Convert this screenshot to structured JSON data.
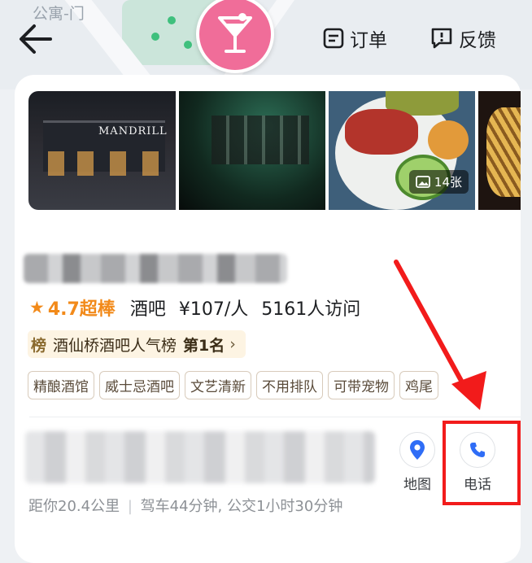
{
  "map": {
    "label": "公寓-门"
  },
  "header": {
    "back_icon": "back-arrow-icon",
    "category_icon": "cocktail-icon",
    "orders_label": "订单",
    "feedback_label": "反馈"
  },
  "gallery": {
    "photo_count_label": "14张"
  },
  "place": {
    "rating": "4.7超棒",
    "category": "酒吧",
    "price": "¥107/人",
    "visits": "5161人访问",
    "rank_badge": "榜",
    "rank_list": "酒仙桥酒吧人气榜",
    "rank_position": "第1名",
    "tags": [
      "精酿酒馆",
      "威士忌酒吧",
      "文艺清新",
      "不用排队",
      "可带宠物",
      "鸡尾"
    ],
    "distance": "距你20.4公里",
    "travel": "驾车44分钟, 公交1小时30分钟"
  },
  "actions": {
    "map_label": "地图",
    "phone_label": "电话"
  },
  "colors": {
    "accent": "#f28a1a",
    "highlight": "#f21b1b",
    "blue": "#2f6df6",
    "pin": "#f06d99"
  }
}
